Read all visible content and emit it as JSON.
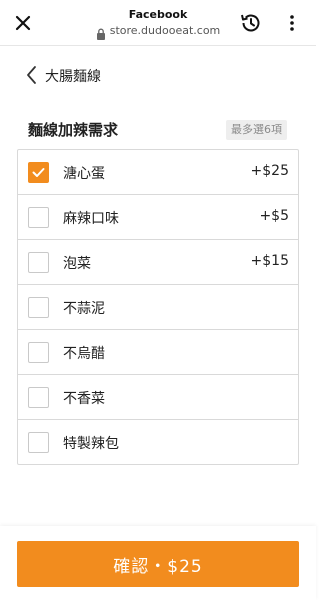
{
  "browser": {
    "title": "Facebook",
    "url": "store.dudooeat.com",
    "icons": [
      "close-icon",
      "lock-icon",
      "history-icon",
      "more-vert-icon"
    ]
  },
  "header": {
    "back_icon": "chevron-left-icon",
    "title": "大腸麵線"
  },
  "section": {
    "title": "麵線加辣需求",
    "limit_badge": "最多選6項"
  },
  "options": [
    {
      "label": "溏心蛋",
      "price": "+$25",
      "checked": true
    },
    {
      "label": "麻辣口味",
      "price": "+$5",
      "checked": false
    },
    {
      "label": "泡菜",
      "price": "+$15",
      "checked": false
    },
    {
      "label": "不蒜泥",
      "price": "",
      "checked": false
    },
    {
      "label": "不烏醋",
      "price": "",
      "checked": false
    },
    {
      "label": "不香菜",
      "price": "",
      "checked": false
    },
    {
      "label": "特製辣包",
      "price": "",
      "checked": false
    }
  ],
  "confirm": {
    "label": "確認・$25"
  },
  "colors": {
    "accent": "#f28c1e",
    "border": "#d9d9d9",
    "badge_bg": "#eeeeee",
    "badge_text": "#8a8a8a"
  }
}
